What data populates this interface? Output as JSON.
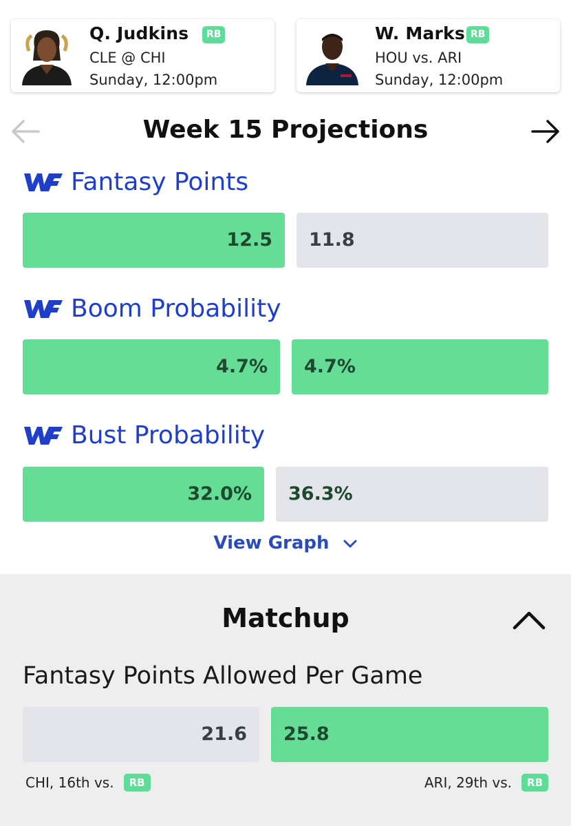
{
  "players": [
    {
      "name": "Q. Judkins",
      "position": "RB",
      "game": "CLE @ CHI",
      "time": "Sunday, 12:00pm"
    },
    {
      "name": "W. Marks",
      "position": "RB",
      "game": "HOU vs. ARI",
      "time": "Sunday, 12:00pm"
    }
  ],
  "header": {
    "title": "Week 15 Projections",
    "prev_icon": "arrow-left-icon",
    "next_icon": "arrow-right-icon"
  },
  "stats": [
    {
      "label": "Fantasy Points",
      "values": [
        "12.5",
        "11.8"
      ]
    },
    {
      "label": "Boom Probability",
      "values": [
        "4.7%",
        "4.7%"
      ]
    },
    {
      "label": "Bust Probability",
      "values": [
        "32.0%",
        "36.3%"
      ]
    }
  ],
  "view_graph": {
    "label": "View Graph"
  },
  "matchup": {
    "title": "Matchup",
    "subtitle": "Fantasy Points Allowed Per Game",
    "values": [
      "21.6",
      "25.8"
    ],
    "ranks": [
      {
        "text": "CHI, 16th vs.",
        "position": "RB"
      },
      {
        "text": "ARI, 29th vs.",
        "position": "RB"
      }
    ]
  },
  "colors": {
    "accent_green": "#66dd97",
    "neutral_gray": "#e4e5ea",
    "label_blue": "#1f3fc9",
    "link_blue": "#2a4bb8"
  }
}
